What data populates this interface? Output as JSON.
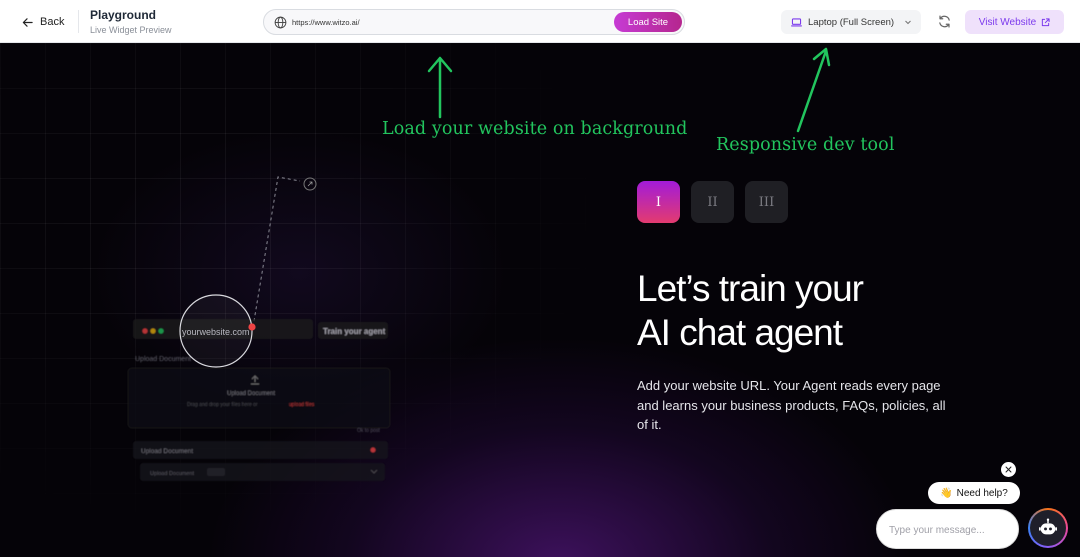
{
  "topbar": {
    "back_label": "Back",
    "title": "Playground",
    "subtitle": "Live Widget Preview",
    "url_value": "https://www.witzo.ai/",
    "load_button": "Load Site",
    "device_label": "Laptop (Full Screen)",
    "visit_button": "Visit Website"
  },
  "annotations": {
    "load_bg": "Load your website on background",
    "responsive": "Responsive dev tool"
  },
  "hero": {
    "steps": [
      "I",
      "II",
      "III"
    ],
    "active_step": 0,
    "heading_line1": "Let’s train your",
    "heading_line2": "AI chat agent",
    "description": "Add your website URL. Your Agent reads every page and learns your business products, FAQs, policies, all of it."
  },
  "mock": {
    "url_placeholder": "yourwebsite.com",
    "train_button": "Train your agent",
    "upload_title": "Upload Document",
    "upload_label": "Upload Document",
    "upload_hint": "Drag and drop your files here or",
    "upload_link": "upload files",
    "row1": "Upload Document",
    "row2": "Upload Document",
    "status": "Ok to post"
  },
  "widget": {
    "need_help": "Need help?",
    "emoji": "👋",
    "message_placeholder": "Type your message..."
  },
  "colors": {
    "accent": "#c63bd4",
    "annotation": "#22c55e",
    "visit_bg": "#efe1fb",
    "visit_text": "#7c3aed"
  }
}
